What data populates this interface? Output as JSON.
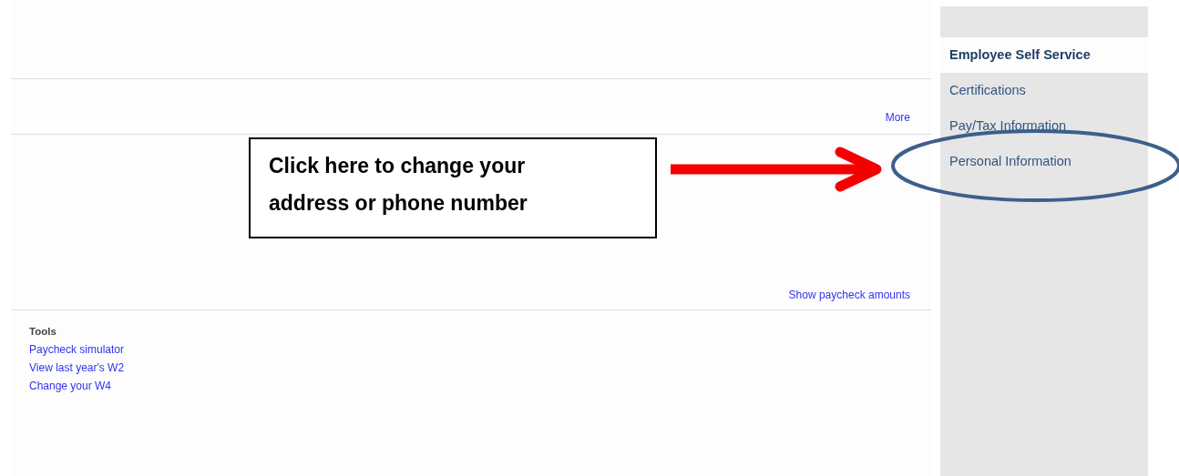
{
  "main": {
    "more_link": "More",
    "paycheck_link": "Show paycheck amounts",
    "tools": {
      "heading": "Tools",
      "links": [
        "Paycheck simulator",
        "View last year's W2",
        "Change your W4"
      ]
    }
  },
  "sidebar": {
    "items": [
      {
        "label": "Employee Self Service",
        "selected": true
      },
      {
        "label": "Certifications",
        "selected": false
      },
      {
        "label": "Pay/Tax Information",
        "selected": false
      },
      {
        "label": "Personal Information",
        "selected": false,
        "circled": true
      }
    ]
  },
  "annotation": {
    "callout": "Click here to change your address or phone number"
  }
}
